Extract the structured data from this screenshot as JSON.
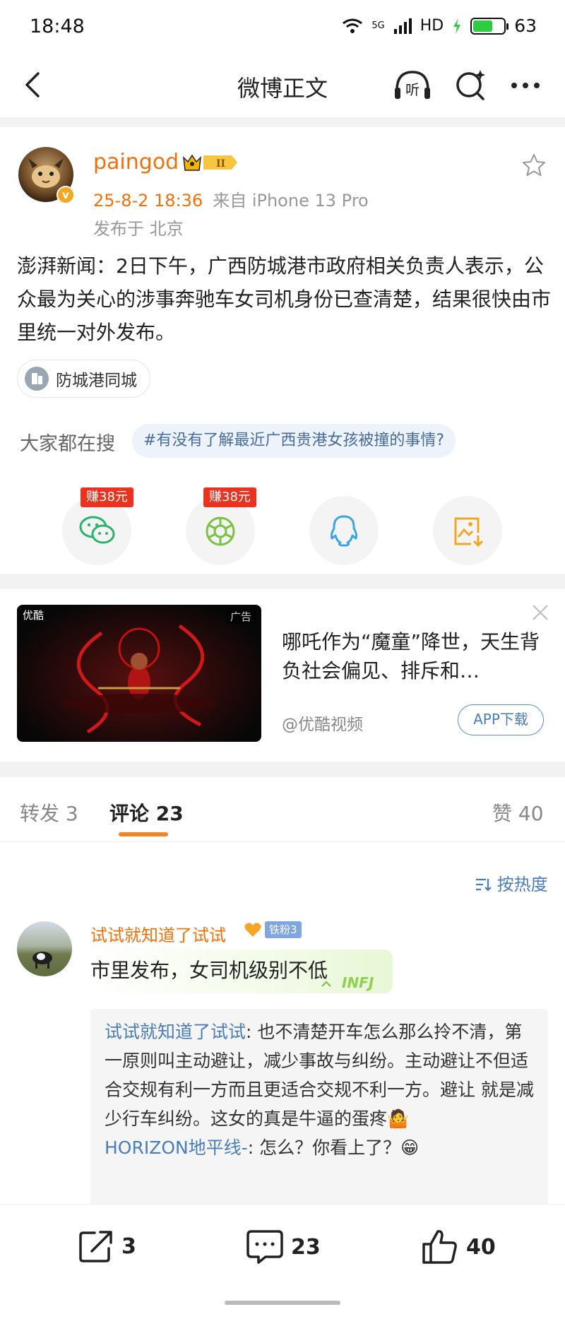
{
  "status_bar": {
    "time": "18:48",
    "network": "5G",
    "hd": "HD",
    "battery": "63",
    "battery_level": 0.63
  },
  "nav": {
    "title": "微博正文",
    "icons": [
      "back-icon",
      "listen-icon",
      "search-icon",
      "more-icon"
    ]
  },
  "post": {
    "author": "paingod",
    "date": "25-8-2 18:36",
    "source": "来自 iPhone 13 Pro",
    "location": "发布于 北京",
    "text": "澎湃新闻：2日下午，广西防城港市政府相关负责人表示，公众最为关心的涉事奔驰车女司机身份已查清楚，结果很快由市里统一对外发布。",
    "location_tag": "防城港同城",
    "search_label": "大家都在搜",
    "search_topic": "#有没有了解最近广西贵港女孩被撞的事情?",
    "share": [
      {
        "name": "wechat",
        "earn": "赚38元",
        "icon": "wechat-icon"
      },
      {
        "name": "moments",
        "earn": "赚38元",
        "icon": "moments-icon"
      },
      {
        "name": "qq",
        "earn": "",
        "icon": "qq-icon"
      },
      {
        "name": "save-image",
        "earn": "",
        "icon": "save-image-icon"
      }
    ]
  },
  "ad": {
    "image_label": "优酷",
    "ad_tag": "广告",
    "title": "哪吒作为“魔童”降世，天生背负社会偏见、排斥和…",
    "source": "@优酷视频",
    "button": "APP下载"
  },
  "tabs": {
    "repost": "转发 3",
    "comment": "评论 23",
    "like": "赞 40"
  },
  "comments": {
    "sort": "按热度",
    "items": [
      {
        "name": "试试就知道了试试",
        "fan_badge": "铁粉3",
        "text": "市里发布，女司机级别不低",
        "replies": [
          {
            "name": "试试就知道了试试",
            "text": ": 也不清楚开车怎么那么拎不清，第一原则叫主动避让，减少事故与纠纷。主动避让不但适合交规有利一方而且更适合交规不利一方。避让 就是减少行车纠纷。这女的真是牛逼的蛋疼🤷"
          },
          {
            "name": "HORIZON地平线-",
            "text": ": 怎么？你看上了？😁"
          }
        ]
      }
    ]
  },
  "bottom_bar": {
    "repost_count": "3",
    "comment_count": "23",
    "like_count": "40"
  },
  "colors": {
    "accent_orange": "#f56f0a",
    "link_blue": "#4a7dbd",
    "earn_red": "#e8331f"
  }
}
